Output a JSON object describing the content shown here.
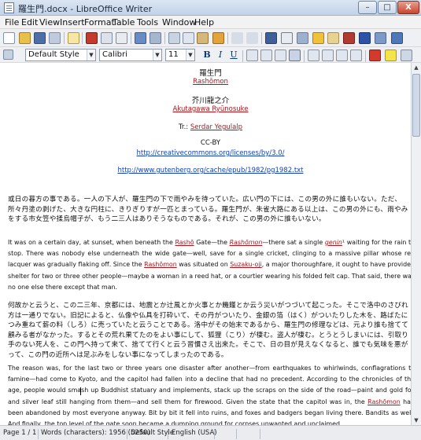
{
  "window": {
    "title": "羅生門.docx - LibreOffice Writer",
    "minimize": "–",
    "maximize": "□",
    "close": "X"
  },
  "menu": [
    "File",
    "Edit",
    "View",
    "Insert",
    "Format",
    "Table",
    "Tools",
    "Window",
    "Help"
  ],
  "format_toolbar": {
    "style": "Default Style",
    "font": "Calibri",
    "size": "11"
  },
  "document": {
    "title_jp": "羅生門",
    "title_en": "Rashōmon",
    "author_jp": "芥川龍之介",
    "author_en": "Akutagawa Ryūnosuke",
    "translator_prefix": "Tr.: ",
    "translator": "Serdar Yegulalp",
    "license": "CC-BY",
    "license_url": "http://creativecommons.org/licenses/by/3.0/",
    "source_url": "http://www.gutenberg.org/cache/epub/1982/pg1982.txt",
    "para1_jp": "或日の暮方の事である。一人の下人が、羅生門の下で雨やみを待っていた。広い門の下には、この男の外に誰もいない。ただ、所々丹塗の剥げた、大きな円柱に、きりぎりすが一匹とまっている。羅生門が、朱雀大路にある以上は、この男の外にも、雨やみをする市女笠や揉烏帽子が、もう二三人はありそうなものである。それが、この男の外に誰もいない。",
    "para1_en": {
      "t1": "It was on a certain day, at sunset, when beneath the ",
      "w1": "Rashō",
      "t2": " Gate—the ",
      "w2": "Rashōmon",
      "t3": "—there sat a single ",
      "w3": "genin",
      "t4": "¹ waiting for the rain to stop. There was nobody else underneath the wide gate—well, save for a single cricket, clinging to a massive pillar whose red lacquer was gradually flaking off. Since the ",
      "w4": "Rashōmon",
      "t5": " was situated on ",
      "w5": "Suzaku-oji",
      "t6": ", a major thoroughfare, it ought to have provided shelter for two or three other people—maybe a woman in a reed hat, or a courtier wearing his folded felt cap. That said, there was no one else there except that man."
    },
    "para2_jp": "何故かと云うと、この二三年、京都には、地震とか辻風とか火事とか饑饉とか云う災いがつづいて起こった。そこで洛中のさびれ方は一通りでない。旧記によると、仏像や仏具を打砕いて、その丹がついたり、金銀の箔（はく）がついたりした木を、路ばたにつみ重ねて薪の料（しろ）に売っていたと云うことである。洛中がその始末であるから、羅生門の修理などは、元より誰も捨てて顧みる者がなかった。するとその荒れ果てたのをよい事にして、狐狸（こり）が棲む。盗人が棲む。とうとうしまいには、引取り手のない死人を、この門へ持って来て、捨てて行くと云う習慣さえ出来た。そこで、日の目が見えなくなると、誰でも気味を悪がって、この門の近所へは足ぶみをしない事になってしまったのである。",
    "para2_en": {
      "t1": "The reason was, for the last two or three years one disaster after another—from earthquakes to whirlwinds, conflagrations to famine—had come to Kyoto, and the capitol had fallen into a decline that had no precedent. According to the chronicles of the age, people would smash up Buddhist statuary and implements, stack up the scraps on the side of the road—paint and gold foil and silver leaf still hanging from them—and sell them for firewood. Given the state that the capitol was in, the ",
      "w1": "Rashōmon",
      "t2": " had been abandoned by most everyone anyway. Bit by bit it fell into ruins, and foxes and badgers began living there. Bandits as well. And finally, the top level of the gate soon became a dumping ground for corpses unwanted and unclaimed."
    }
  },
  "statusbar": {
    "page": "Page 1 / 1",
    "words": "Words (characters): 1956 (5250)",
    "style": "Default Style",
    "language": "English (USA)"
  },
  "colors": {
    "link": "#0f3fc4",
    "spell_underline": "#b0151b"
  }
}
